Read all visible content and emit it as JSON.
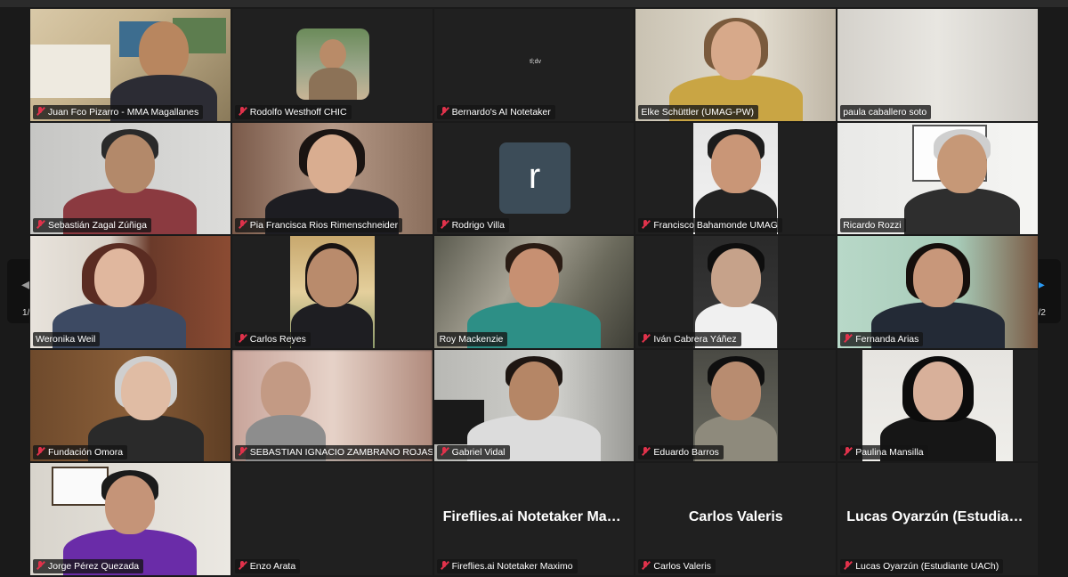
{
  "pager": {
    "left_label": "1/2",
    "right_label": "1/2"
  },
  "participants": [
    {
      "name": "Juan Fco Pizarro - MMA Magallanes"
    },
    {
      "name": "Rodolfo Westhoff CHIC"
    },
    {
      "name": "Bernardo's AI Notetaker"
    },
    {
      "name": "Elke Schüttler (UMAG-PW)"
    },
    {
      "name": "paula caballero soto"
    },
    {
      "name": "Sebastián Zagal Zúñiga"
    },
    {
      "name": "Pia Francisca Rios Rimenschneider"
    },
    {
      "name": "Rodrigo Villa",
      "avatar_letter": "r"
    },
    {
      "name": "Francisco Bahamonde UMAG"
    },
    {
      "name": "Ricardo Rozzi"
    },
    {
      "name": "Weronika Weil"
    },
    {
      "name": "Carlos Reyes"
    },
    {
      "name": "Roy Mackenzie"
    },
    {
      "name": "Iván Cabrera Yáñez"
    },
    {
      "name": "Fernanda Arias"
    },
    {
      "name": "Fundación Omora"
    },
    {
      "name": "SEBASTIAN IGNACIO ZAMBRANO ROJAS"
    },
    {
      "name": "Gabriel Vidal"
    },
    {
      "name": "Eduardo Barros"
    },
    {
      "name": "Paulina Mansilla"
    },
    {
      "name": "Jorge Pérez Quezada"
    },
    {
      "name": "Enzo Arata"
    },
    {
      "name": "Fireflies.ai Notetaker Maximo",
      "display_name": "Fireflies.ai Notetaker Maxi…"
    },
    {
      "name": "Carlos Valeris",
      "display_name": "Carlos Valeris"
    },
    {
      "name": "Lucas Oyarzún (Estudiante UACh)",
      "display_name": "Lucas Oyarzún (Estudiant…"
    }
  ],
  "notetaker_logo": "tl;dv",
  "colors": {
    "muted_mic": "#e0324b",
    "nav_active": "#2a9af3",
    "avatar_bg": "#3c4c58"
  }
}
